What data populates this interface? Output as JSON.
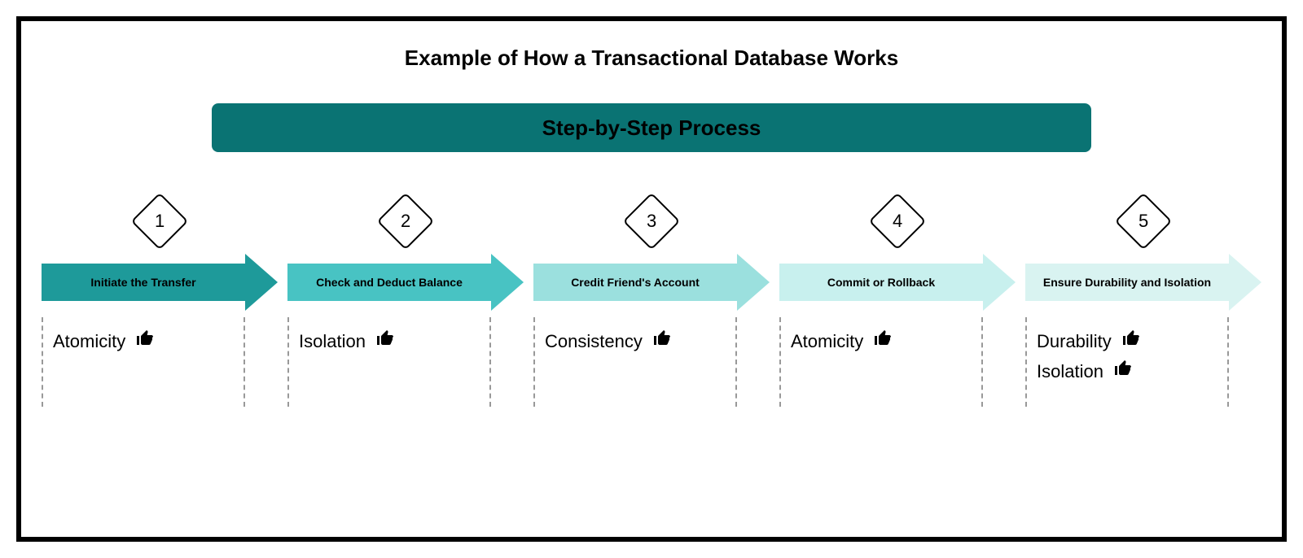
{
  "title": "Example of How a Transactional Database Works",
  "banner": "Step-by-Step Process",
  "steps": [
    {
      "num": "1",
      "label": "Initiate the Transfer",
      "props": [
        "Atomicity"
      ]
    },
    {
      "num": "2",
      "label": "Check and Deduct Balance",
      "props": [
        "Isolation"
      ]
    },
    {
      "num": "3",
      "label": "Credit Friend's Account",
      "props": [
        "Consistency"
      ]
    },
    {
      "num": "4",
      "label": "Commit or Rollback",
      "props": [
        "Atomicity"
      ]
    },
    {
      "num": "5",
      "label": "Ensure Durability and Isolation",
      "props": [
        "Durability",
        "Isolation"
      ]
    }
  ]
}
